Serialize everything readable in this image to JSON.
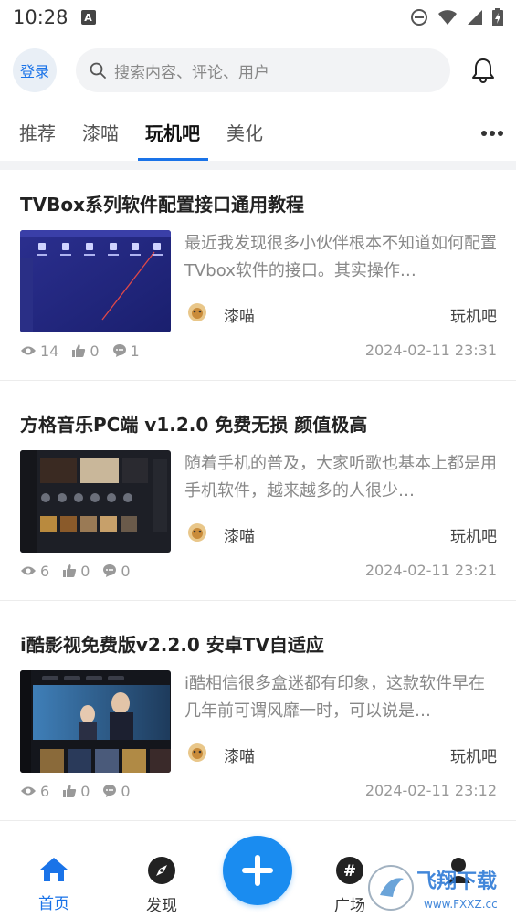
{
  "status": {
    "time": "10:28",
    "a_badge": "A"
  },
  "header": {
    "login_label": "登录",
    "search_placeholder": "搜索内容、评论、用户"
  },
  "tabs": [
    {
      "label": "推荐"
    },
    {
      "label": "漆喵"
    },
    {
      "label": "玩机吧"
    },
    {
      "label": "美化"
    }
  ],
  "active_tab": "玩机吧",
  "posts": [
    {
      "title": "TVBox系列软件配置接口通用教程",
      "excerpt": "最近我发现很多小伙伴根本不知道如何配置TVbox软件的接口。其实操作…",
      "author": "漆喵",
      "category": "玩机吧",
      "views": "14",
      "likes": "0",
      "comments": "1",
      "date": "2024-02-11 23:31"
    },
    {
      "title": "方格音乐PC端 v1.2.0 免费无损 颜值极高",
      "excerpt": "随着手机的普及，大家听歌也基本上都是用手机软件，越来越多的人很少…",
      "author": "漆喵",
      "category": "玩机吧",
      "views": "6",
      "likes": "0",
      "comments": "0",
      "date": "2024-02-11 23:21"
    },
    {
      "title": "i酷影视免费版v2.2.0 安卓TV自适应",
      "excerpt": "i酷相信很多盒迷都有印象，这款软件早在几年前可谓风靡一时，可以说是…",
      "author": "漆喵",
      "category": "玩机吧",
      "views": "6",
      "likes": "0",
      "comments": "0",
      "date": "2024-02-11 23:12"
    }
  ],
  "bottom_nav": [
    {
      "label": "首页",
      "icon": "home-icon"
    },
    {
      "label": "发现",
      "icon": "compass-icon"
    },
    {
      "label": "广场",
      "icon": "hashtag-icon"
    }
  ],
  "watermark": {
    "text": "飞翔下载",
    "sub": "www.FXXZ.cc"
  },
  "colors": {
    "accent": "#1a73e8",
    "fab": "#1a8cf0"
  }
}
